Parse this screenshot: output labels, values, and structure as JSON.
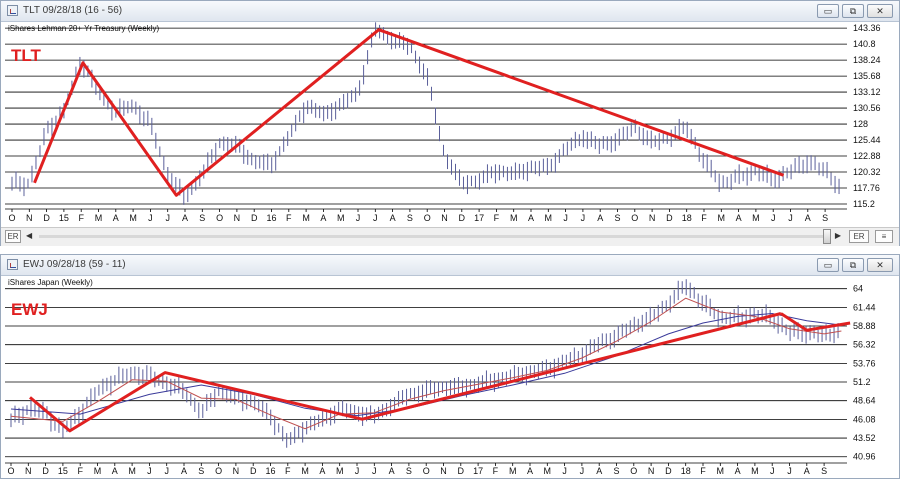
{
  "windows": [
    {
      "id": "tlt",
      "title": "TLT 09/28/18 (16 - 56)",
      "controls": {
        "minimize": "▭",
        "restore": "⧉",
        "close": "✕"
      },
      "subtitle": "iShares Lehman 20+ Yr Treasury (Weekly)",
      "scroll": {
        "left_label": "ER",
        "right_label": "ER"
      }
    },
    {
      "id": "ewj",
      "title": "EWJ 09/28/18 (59 - 11)",
      "controls": {
        "minimize": "▭",
        "restore": "⧉",
        "close": "✕"
      },
      "subtitle": "iShares Japan (Weekly)"
    }
  ],
  "colors": {
    "trend": "#e02020",
    "bars": "#5a5f9a",
    "ma_short": "#c05050",
    "ma_long": "#3a3a9a",
    "grid": "#000000"
  },
  "chart_data": [
    {
      "type": "bar",
      "style": "ohlc-weekly",
      "ticker_label": "TLT",
      "title": "iShares Lehman 20+ Yr Treasury (Weekly)",
      "x_ticks": [
        "O",
        "N",
        "D",
        "15",
        "F",
        "M",
        "A",
        "M",
        "J",
        "J",
        "A",
        "S",
        "O",
        "N",
        "D",
        "16",
        "F",
        "M",
        "A",
        "M",
        "J",
        "J",
        "A",
        "S",
        "O",
        "N",
        "D",
        "17",
        "F",
        "M",
        "A",
        "M",
        "J",
        "J",
        "A",
        "S",
        "O",
        "N",
        "D",
        "18",
        "F",
        "M",
        "A",
        "M",
        "J",
        "J",
        "A",
        "S"
      ],
      "y_ticks": [
        115.2,
        117.76,
        120.32,
        122.88,
        125.44,
        128,
        130.56,
        133.12,
        135.68,
        138.24,
        140.8,
        143.36
      ],
      "ylim": [
        114.4,
        144.5
      ],
      "grid": true,
      "price_path": [
        [
          0,
          118.5
        ],
        [
          1,
          118.5
        ],
        [
          2,
          127
        ],
        [
          3,
          130
        ],
        [
          4,
          138.2
        ],
        [
          5,
          133
        ],
        [
          6,
          130
        ],
        [
          7,
          131
        ],
        [
          8,
          128
        ],
        [
          9,
          120
        ],
        [
          10,
          116.2
        ],
        [
          11,
          120
        ],
        [
          12,
          125
        ],
        [
          13,
          124.5
        ],
        [
          14,
          122
        ],
        [
          15,
          121.5
        ],
        [
          16,
          126
        ],
        [
          17,
          131
        ],
        [
          18,
          129.5
        ],
        [
          19,
          131
        ],
        [
          20,
          133
        ],
        [
          21,
          143.2
        ],
        [
          22,
          141.5
        ],
        [
          23,
          140.5
        ],
        [
          24,
          135.5
        ],
        [
          25,
          123
        ],
        [
          26,
          118.5
        ],
        [
          27,
          119
        ],
        [
          28,
          120.5
        ],
        [
          29,
          120
        ],
        [
          30,
          121
        ],
        [
          31,
          121
        ],
        [
          32,
          124
        ],
        [
          33,
          126
        ],
        [
          34,
          124.5
        ],
        [
          35,
          125.5
        ],
        [
          36,
          127.5
        ],
        [
          37,
          125
        ],
        [
          38,
          126
        ],
        [
          39,
          127.5
        ],
        [
          40,
          122
        ],
        [
          41,
          118.5
        ],
        [
          42,
          119.5
        ],
        [
          43,
          120.5
        ],
        [
          44,
          119
        ],
        [
          45,
          120.5
        ],
        [
          46,
          122
        ],
        [
          47,
          120.5
        ],
        [
          48,
          117.5
        ]
      ],
      "trend_lines": [
        {
          "points": [
            [
              1.3,
              118.6
            ],
            [
              4.1,
              137.8
            ],
            [
              9.5,
              116.6
            ],
            [
              21.2,
              143.1
            ],
            [
              44.6,
              119.8
            ]
          ]
        }
      ]
    },
    {
      "type": "bar",
      "style": "ohlc-weekly-with-moving-averages",
      "ticker_label": "EWJ",
      "title": "iShares Japan (Weekly)",
      "x_ticks": [
        "O",
        "N",
        "D",
        "15",
        "F",
        "M",
        "A",
        "M",
        "J",
        "J",
        "A",
        "S",
        "O",
        "N",
        "D",
        "16",
        "F",
        "M",
        "A",
        "M",
        "J",
        "J",
        "A",
        "S",
        "O",
        "N",
        "D",
        "17",
        "F",
        "M",
        "A",
        "M",
        "J",
        "J",
        "A",
        "S",
        "O",
        "N",
        "D",
        "18",
        "F",
        "M",
        "A",
        "M",
        "J",
        "J",
        "A",
        "S"
      ],
      "y_ticks": [
        40.96,
        43.52,
        46.08,
        48.64,
        51.2,
        53.76,
        56.32,
        58.88,
        61.44,
        64
      ],
      "ylim": [
        40.1,
        65.6
      ],
      "grid": true,
      "price_path": [
        [
          0,
          46
        ],
        [
          1,
          47.5
        ],
        [
          2,
          47
        ],
        [
          3,
          44.5
        ],
        [
          4,
          47
        ],
        [
          5,
          50
        ],
        [
          6,
          51.5
        ],
        [
          7,
          52.5
        ],
        [
          8,
          52
        ],
        [
          9,
          51
        ],
        [
          10,
          50
        ],
        [
          11,
          47
        ],
        [
          12,
          50
        ],
        [
          13,
          49
        ],
        [
          14,
          48.5
        ],
        [
          15,
          46.5
        ],
        [
          16,
          43
        ],
        [
          17,
          45
        ],
        [
          18,
          46
        ],
        [
          19,
          47.5
        ],
        [
          20,
          47
        ],
        [
          21,
          46.5
        ],
        [
          22,
          48
        ],
        [
          23,
          49.5
        ],
        [
          24,
          50
        ],
        [
          25,
          50.5
        ],
        [
          26,
          50.5
        ],
        [
          27,
          51
        ],
        [
          28,
          51.5
        ],
        [
          29,
          52
        ],
        [
          30,
          52.5
        ],
        [
          31,
          53
        ],
        [
          32,
          54
        ],
        [
          33,
          55
        ],
        [
          34,
          56.5
        ],
        [
          35,
          57.5
        ],
        [
          36,
          59
        ],
        [
          37,
          60
        ],
        [
          38,
          62
        ],
        [
          39,
          64.5
        ],
        [
          40,
          62
        ],
        [
          41,
          60
        ],
        [
          42,
          60
        ],
        [
          43,
          60.5
        ],
        [
          44,
          60
        ],
        [
          45,
          58
        ],
        [
          46,
          58
        ],
        [
          47,
          57.5
        ],
        [
          48,
          58.5
        ]
      ],
      "ma_short": [
        [
          0,
          46.5
        ],
        [
          3,
          45.8
        ],
        [
          5,
          48.5
        ],
        [
          7,
          51.5
        ],
        [
          9,
          51.3
        ],
        [
          11,
          49
        ],
        [
          13,
          48.8
        ],
        [
          15,
          46.7
        ],
        [
          17,
          44.8
        ],
        [
          19,
          46.8
        ],
        [
          21,
          47
        ],
        [
          23,
          48.8
        ],
        [
          25,
          50
        ],
        [
          27,
          50.9
        ],
        [
          29,
          51.8
        ],
        [
          31,
          52.8
        ],
        [
          33,
          54.5
        ],
        [
          35,
          56.8
        ],
        [
          37,
          59.5
        ],
        [
          39,
          62.7
        ],
        [
          41,
          60.8
        ],
        [
          43,
          60.2
        ],
        [
          45,
          58.5
        ],
        [
          47,
          57.8
        ],
        [
          48,
          58.2
        ]
      ],
      "ma_long": [
        [
          0,
          47.5
        ],
        [
          4,
          46.8
        ],
        [
          8,
          49.5
        ],
        [
          11,
          50.8
        ],
        [
          14,
          49.5
        ],
        [
          17,
          47.6
        ],
        [
          20,
          46.6
        ],
        [
          23,
          47.6
        ],
        [
          26,
          49.3
        ],
        [
          29,
          50.8
        ],
        [
          32,
          52.4
        ],
        [
          35,
          54.8
        ],
        [
          38,
          57.8
        ],
        [
          40,
          59.3
        ],
        [
          42,
          60.2
        ],
        [
          44,
          60.6
        ],
        [
          46,
          59.6
        ],
        [
          48,
          59
        ]
      ],
      "trend_lines": [
        {
          "points": [
            [
              1.1,
              49.1
            ],
            [
              3.4,
              44.5
            ],
            [
              8.9,
              52.5
            ],
            [
              20.3,
              46.1
            ],
            [
              44.5,
              60.6
            ]
          ]
        },
        {
          "points": [
            [
              44.5,
              60.6
            ],
            [
              46,
              58.3
            ],
            [
              48.5,
              59.3
            ]
          ]
        }
      ]
    }
  ]
}
